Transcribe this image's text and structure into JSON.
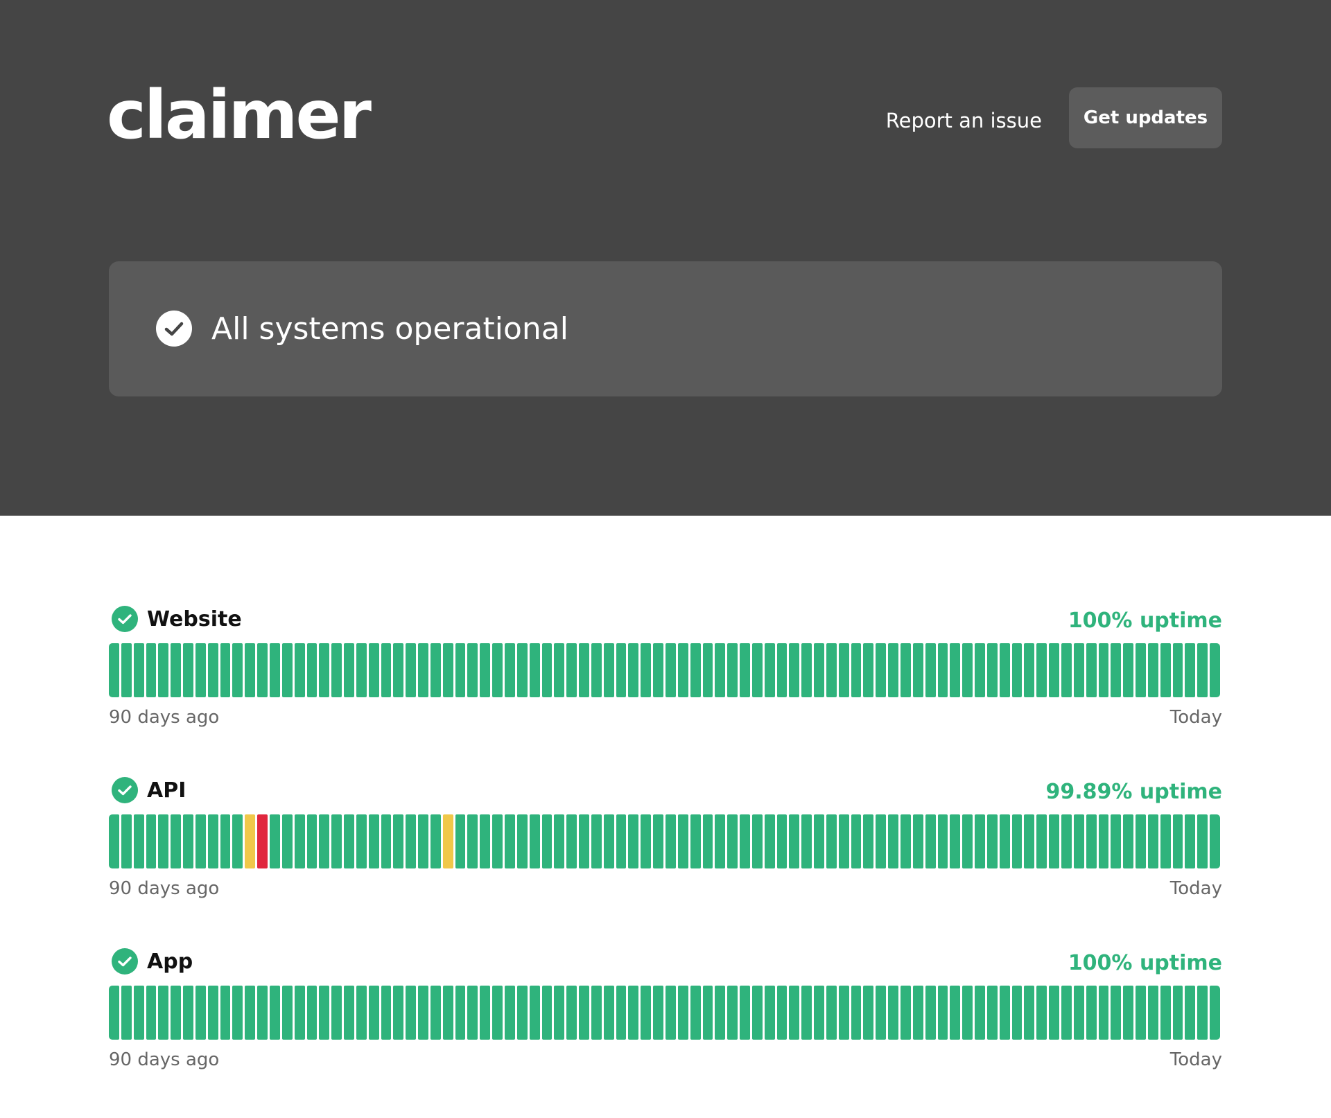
{
  "header": {
    "logo_text": "claimer",
    "report_link": "Report an issue",
    "updates_button": "Get updates"
  },
  "status": {
    "text": "All systems operational"
  },
  "colors": {
    "operational": "#2fb37c",
    "degraded": "#f0c84a",
    "outage": "#e0273e",
    "header_bg": "#454545",
    "banner_bg": "#5a5a5a"
  },
  "components": [
    {
      "name": "Website",
      "uptime": "100% uptime",
      "start_label": "90 days ago",
      "end_label": "Today",
      "days": 90,
      "degraded_days": [],
      "outage_days": []
    },
    {
      "name": "API",
      "uptime": "99.89% uptime",
      "start_label": "90 days ago",
      "end_label": "Today",
      "days": 90,
      "degraded_days": [
        11,
        27
      ],
      "outage_days": [
        12
      ]
    },
    {
      "name": "App",
      "uptime": "100% uptime",
      "start_label": "90 days ago",
      "end_label": "Today",
      "days": 90,
      "degraded_days": [],
      "outage_days": []
    }
  ]
}
